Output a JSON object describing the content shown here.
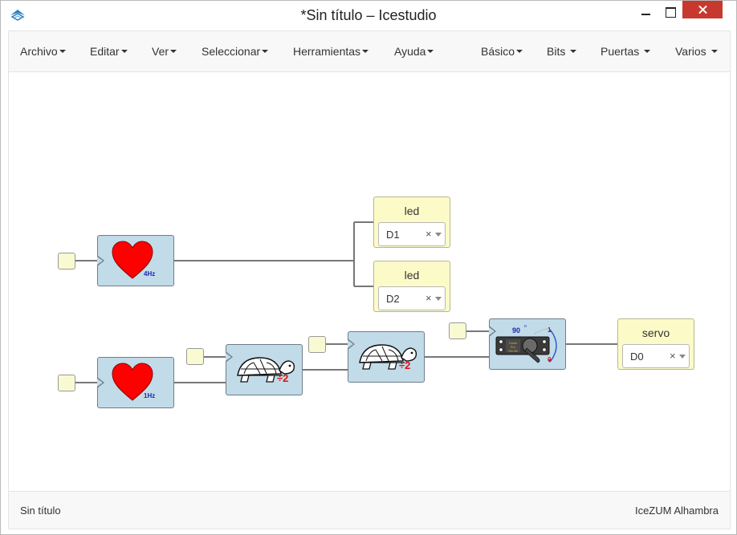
{
  "window": {
    "title": "*Sin título – Icestudio"
  },
  "menu": {
    "left": [
      {
        "label": "Archivo"
      },
      {
        "label": "Editar"
      },
      {
        "label": "Ver"
      },
      {
        "label": "Seleccionar"
      },
      {
        "label": "Herramientas"
      },
      {
        "label": "Ayuda"
      }
    ],
    "right": [
      {
        "label": "Básico"
      },
      {
        "label": "Bits"
      },
      {
        "label": "Puertas"
      },
      {
        "label": "Varios"
      }
    ]
  },
  "blocks": {
    "heart1": {
      "freq": "4Hz"
    },
    "heart2": {
      "freq": "1Hz"
    },
    "led1": {
      "label": "led",
      "pin": "D1",
      "clear": "×"
    },
    "led2": {
      "label": "led",
      "pin": "D2",
      "clear": "×"
    },
    "servo": {
      "label": "servo",
      "pin": "D0",
      "clear": "×"
    },
    "div1": {
      "label": "÷2"
    },
    "div2": {
      "label": "÷2"
    },
    "servo_icon": {
      "angle": "90",
      "one": "1",
      "zero": "0"
    }
  },
  "footer": {
    "left": "Sin título",
    "right": "IceZUM Alhambra"
  },
  "colors": {
    "block_blue": "#c2dbe8",
    "block_yellow": "#fcfbc8",
    "heart": "#ff0000",
    "close_red": "#c7392e"
  }
}
